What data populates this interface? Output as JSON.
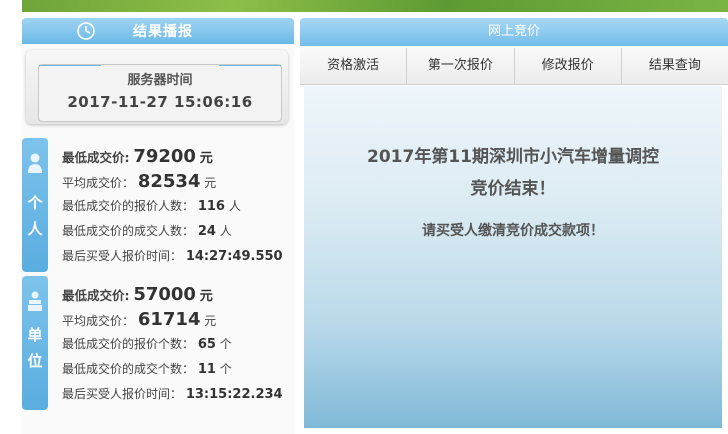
{
  "left_panel": {
    "title": "结果播报",
    "server_time": {
      "label": "服务器时间",
      "value": "2017-11-27 15:06:16"
    },
    "personal": {
      "tab_chars": [
        "个",
        "人"
      ],
      "lowest_price_label": "最低成交价:",
      "lowest_price_value": "79200",
      "avg_price_label": "平均成交价：",
      "avg_price_value": "82534",
      "unit_yuan": "元",
      "lowest_bidders_label": "最低成交价的报价人数：",
      "lowest_bidders_value": "116",
      "lowest_deals_label": "最低成交价的成交人数：",
      "lowest_deals_value": "24",
      "unit_person": "人",
      "last_bid_label": "最后买受人报价时间：",
      "last_bid_value": "14:27:49.550"
    },
    "company": {
      "tab_chars": [
        "单",
        "位"
      ],
      "lowest_price_label": "最低成交价:",
      "lowest_price_value": "57000",
      "avg_price_label": "平均成交价：",
      "avg_price_value": "61714",
      "unit_yuan": "元",
      "lowest_bidders_label": "最低成交价的报价个数：",
      "lowest_bidders_value": "65",
      "lowest_deals_label": "最低成交价的成交个数：",
      "lowest_deals_value": "11",
      "unit_count": "个",
      "last_bid_label": "最后买受人报价时间：",
      "last_bid_value": "13:15:22.234"
    }
  },
  "right_panel": {
    "title": "网上竞价",
    "tabs": [
      "资格激活",
      "第一次报价",
      "修改报价",
      "结果查询"
    ],
    "content": {
      "title_line1": "2017年第11期深圳市小汽车增量调控",
      "title_line2": "竞价结束！",
      "note": "请买受人缴清竞价成交款项！"
    }
  },
  "colors": {
    "accent_blue": "#6ab9e6",
    "header_text": "#ffffff",
    "banner_green": "#7ab544"
  }
}
